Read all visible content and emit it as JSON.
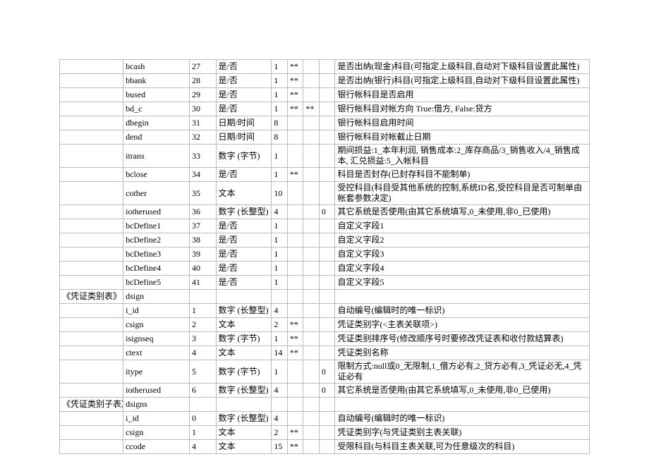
{
  "rows": [
    {
      "g": "",
      "f": "bcash",
      "n": "27",
      "t": "是/否",
      "l": "1",
      "a": "**",
      "b": "",
      "d": "",
      "desc": "是否出纳(现金)科目(可指定上级科目,自动对下级科目设置此属性)"
    },
    {
      "g": "",
      "f": "bbank",
      "n": "28",
      "t": "是/否",
      "l": "1",
      "a": "**",
      "b": "",
      "d": "",
      "desc": "是否出纳(银行)科目(可指定上级科目,自动对下级科目设置此属性)"
    },
    {
      "g": "",
      "f": "bused",
      "n": "29",
      "t": "是/否",
      "l": "1",
      "a": "**",
      "b": "",
      "d": "",
      "desc": "银行帐科目是否启用"
    },
    {
      "g": "",
      "f": "bd_c",
      "n": "30",
      "t": "是/否",
      "l": "1",
      "a": "**",
      "b": "**",
      "d": "",
      "desc": "银行帐科目对帐方向 True:借方, False:贷方"
    },
    {
      "g": "",
      "f": "dbegin",
      "n": "31",
      "t": "日期/时间",
      "l": "8",
      "a": "",
      "b": "",
      "d": "",
      "desc": "银行帐科目启用时间"
    },
    {
      "g": "",
      "f": "dend",
      "n": "32",
      "t": "日期/时间",
      "l": "8",
      "a": "",
      "b": "",
      "d": "",
      "desc": "银行帐科目对帐截止日期"
    },
    {
      "g": "",
      "f": "itrans",
      "n": "33",
      "t": "数字 (字节)",
      "l": "1",
      "a": "",
      "b": "",
      "d": "",
      "desc": "期间损益:1_本年利润, 销售成本:2_库存商品/3_销售收入/4_销售成本, 汇兑损益:5_入帐科目"
    },
    {
      "g": "",
      "f": "bclose",
      "n": "34",
      "t": "是/否",
      "l": "1",
      "a": "**",
      "b": "",
      "d": "",
      "desc": "科目是否封存(已封存科目不能制单)"
    },
    {
      "g": "",
      "f": "cother",
      "n": "35",
      "t": "文本",
      "l": "10",
      "a": "",
      "b": "",
      "d": "",
      "desc": "受控科目(科目受其他系统的控制,系统ID名,受控科目是否可制单由帐套参数决定)"
    },
    {
      "g": "",
      "f": "iotherused",
      "n": "36",
      "t": "数字 (长整型)",
      "l": "4",
      "a": "",
      "b": "",
      "d": "0",
      "desc": "其它系统是否使用(由其它系统填写,0_未使用,非0_已使用)"
    },
    {
      "g": "",
      "f": "bcDefine1",
      "n": "37",
      "t": "是/否",
      "l": "1",
      "a": "",
      "b": "",
      "d": "",
      "desc": "自定义字段1"
    },
    {
      "g": "",
      "f": "bcDefine2",
      "n": "38",
      "t": "是/否",
      "l": "1",
      "a": "",
      "b": "",
      "d": "",
      "desc": "自定义字段2"
    },
    {
      "g": "",
      "f": "bcDefine3",
      "n": "39",
      "t": "是/否",
      "l": "1",
      "a": "",
      "b": "",
      "d": "",
      "desc": "自定义字段3"
    },
    {
      "g": "",
      "f": "bcDefine4",
      "n": "40",
      "t": "是/否",
      "l": "1",
      "a": "",
      "b": "",
      "d": "",
      "desc": "自定义字段4"
    },
    {
      "g": "",
      "f": "bcDefine5",
      "n": "41",
      "t": "是/否",
      "l": "1",
      "a": "",
      "b": "",
      "d": "",
      "desc": "自定义字段5"
    },
    {
      "g": "《凭证类别表》",
      "f": "dsign",
      "n": "",
      "t": "",
      "l": "",
      "a": "",
      "b": "",
      "d": "",
      "desc": ""
    },
    {
      "g": "",
      "f": "i_id",
      "n": "1",
      "t": "数字 (长整型)",
      "l": "4",
      "a": "",
      "b": "",
      "d": "",
      "desc": "自动编号(编辑时的唯一标识)"
    },
    {
      "g": "",
      "f": "csign",
      "n": "2",
      "t": "文本",
      "l": "2",
      "a": "**",
      "b": "",
      "d": "",
      "desc": "凭证类别字(<主表关联项>)"
    },
    {
      "g": "",
      "f": "isignseq",
      "n": "3",
      "t": "数字 (字节)",
      "l": "1",
      "a": "**",
      "b": "",
      "d": "",
      "desc": "凭证类别排序号(修改顺序号时要修改凭证表和收付款结算表)"
    },
    {
      "g": "",
      "f": "ctext",
      "n": "4",
      "t": "文本",
      "l": "14",
      "a": "**",
      "b": "",
      "d": "",
      "desc": "凭证类别名称"
    },
    {
      "g": "",
      "f": "itype",
      "n": "5",
      "t": "数字 (字节)",
      "l": "1",
      "a": "",
      "b": "",
      "d": "0",
      "desc": "限制方式:null或0_无限制,1_借方必有,2_贷方必有,3_凭证必无,4_凭证必有"
    },
    {
      "g": "",
      "f": "iotherused",
      "n": "6",
      "t": "数字 (长整型)",
      "l": "4",
      "a": "",
      "b": "",
      "d": "0",
      "desc": "其它系统是否使用(由其它系统填写,0_未使用,非0_已使用)"
    },
    {
      "g": "《凭证类别子表》",
      "f": "dsigns",
      "n": "",
      "t": "",
      "l": "",
      "a": "",
      "b": "",
      "d": "",
      "desc": ""
    },
    {
      "g": "",
      "f": "i_id",
      "n": "0",
      "t": "数字 (长整型)",
      "l": "4",
      "a": "",
      "b": "",
      "d": "",
      "desc": "自动编号(编辑时的唯一标识)"
    },
    {
      "g": "",
      "f": "csign",
      "n": "1",
      "t": "文本",
      "l": "2",
      "a": "**",
      "b": "",
      "d": "",
      "desc": "凭证类别字(与凭证类别主表关联)"
    },
    {
      "g": "",
      "f": "ccode",
      "n": "4",
      "t": "文本",
      "l": "15",
      "a": "**",
      "b": "",
      "d": "",
      "desc": "受限科目(与科目主表关联,可为任意级次的科目)"
    }
  ]
}
